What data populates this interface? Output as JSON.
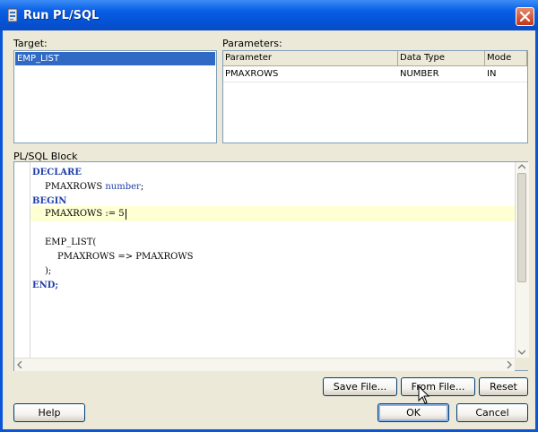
{
  "window": {
    "title": "Run PL/SQL",
    "icon": "plsql-app-icon",
    "close_icon": "close-icon"
  },
  "target": {
    "label": "Target:",
    "items": [
      "EMP_LIST"
    ],
    "selected": "EMP_LIST"
  },
  "parameters": {
    "label": "Parameters:",
    "columns": [
      "Parameter",
      "Data Type",
      "Mode"
    ],
    "rows": [
      [
        "PMAXROWS",
        "NUMBER",
        "IN"
      ]
    ]
  },
  "block": {
    "label": "PL/SQL Block",
    "lines": {
      "l1": "DECLARE",
      "l2_name": "PMAXROWS ",
      "l2_type": "number",
      "l2_end": ";",
      "l3": "BEGIN",
      "l4": "PMAXROWS := 5",
      "l6": "EMP_LIST(",
      "l7": "PMAXROWS => PMAXROWS",
      "l8": ");",
      "l9": "END;"
    }
  },
  "buttons": {
    "save_file": "Save File...",
    "from_file": "From File...",
    "reset": "Reset",
    "help": "Help",
    "ok": "OK",
    "cancel": "Cancel"
  },
  "colors": {
    "title_bar": "#0a5fe6",
    "selection": "#316ac5",
    "keyword": "#1f3fa8",
    "current_line": "#ffffd4"
  }
}
